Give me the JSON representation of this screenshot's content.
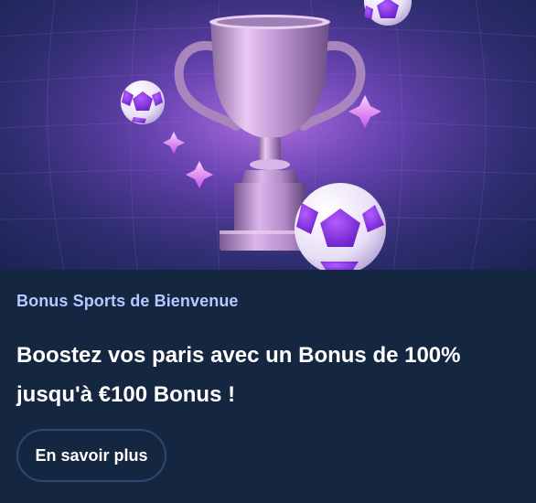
{
  "promo": {
    "image_alt": "trophy-with-soccer-balls-illustration",
    "eyebrow": "Bonus Sports de Bienvenue",
    "headline": "Boostez vos paris avec un Bonus de 100% jusqu'à €100 Bonus !",
    "cta_label": "En savoir plus"
  },
  "colors": {
    "background": "#142640",
    "eyebrow": "#b6c8ff",
    "headline": "#ffffff",
    "button_border": "#30476f"
  }
}
